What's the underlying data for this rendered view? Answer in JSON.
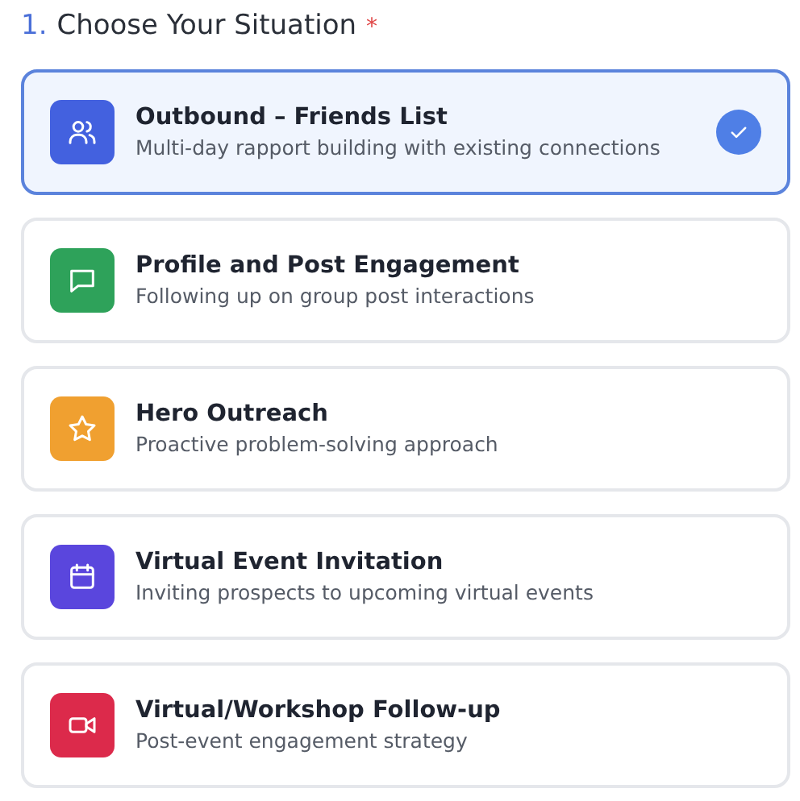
{
  "heading": {
    "number": "1.",
    "title": "Choose Your Situation",
    "required_mark": "*"
  },
  "options": [
    {
      "kind": "users",
      "color": "#4361df",
      "title": "Outbound – Friends List",
      "description": "Multi-day rapport building with existing connections",
      "selected": true
    },
    {
      "kind": "message",
      "color": "#2ea25a",
      "title": "Profile and Post Engagement",
      "description": "Following up on group post interactions",
      "selected": false
    },
    {
      "kind": "star",
      "color": "#f0a030",
      "title": "Hero Outreach",
      "description": "Proactive problem-solving approach",
      "selected": false
    },
    {
      "kind": "calendar",
      "color": "#5a46dd",
      "title": "Virtual Event Invitation",
      "description": "Inviting prospects to upcoming virtual events",
      "selected": false
    },
    {
      "kind": "video",
      "color": "#dc2a4b",
      "title": "Virtual/Workshop Follow-up",
      "description": "Post-event engagement strategy",
      "selected": false
    }
  ]
}
